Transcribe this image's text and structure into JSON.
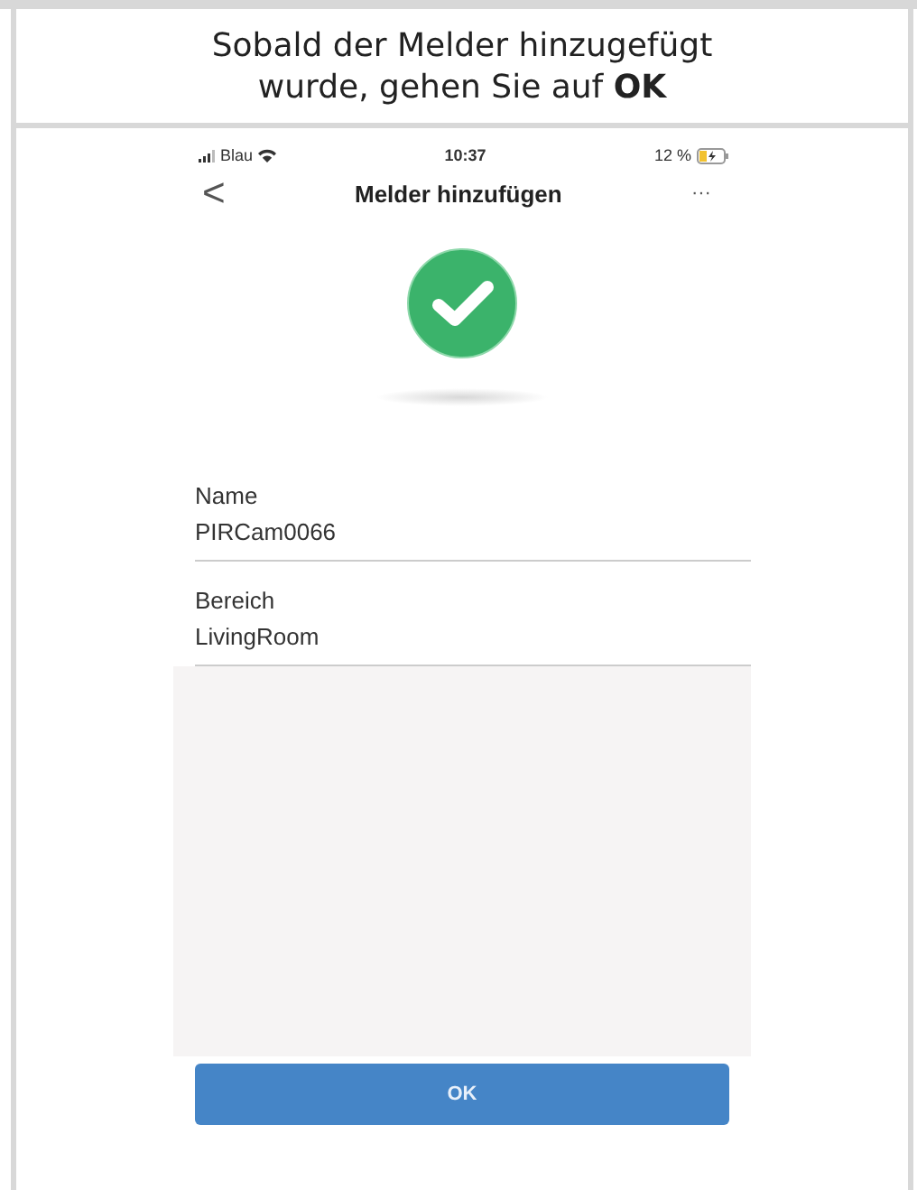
{
  "instruction": "Sobald der Melder hinzugefügt wurde, gehen Sie auf **OK**",
  "status_bar": {
    "carrier": "Blau",
    "time": "10:37",
    "battery": "12 %"
  },
  "nav": {
    "back": "<",
    "title": "Melder hinzufügen",
    "menu": "···"
  },
  "fields": [
    {
      "label": "Name",
      "value": "PIRCam0066"
    },
    {
      "label": "Bereich",
      "value": "LivingRoom"
    }
  ],
  "button": "OK"
}
